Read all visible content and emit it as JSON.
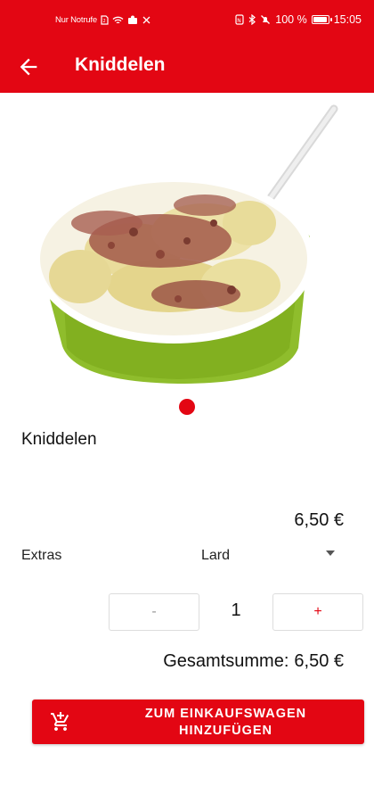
{
  "status_bar": {
    "carrier": "Nur Notrufe",
    "battery": "100 %",
    "battery_level": 1.0,
    "time": "15:05"
  },
  "app_bar": {
    "title": "Kniddelen",
    "back_icon": "arrow-back-icon"
  },
  "product": {
    "name": "Kniddelen",
    "price": "6,50 €",
    "image_pagination": {
      "current": 1,
      "total": 1
    }
  },
  "extras": {
    "label": "Extras",
    "selected": "Lard"
  },
  "quantity": {
    "minus_label": "-",
    "plus_label": "+",
    "value": "1"
  },
  "total": {
    "label": "Gesamtsumme:",
    "value": "6,50 €"
  },
  "cart_button": {
    "line1": "ZUM EINKAUFSWAGEN",
    "line2": "HINZUFÜGEN",
    "icon": "cart-add-icon"
  },
  "colors": {
    "primary": "#e30613",
    "bowl": "#8fbd2c"
  }
}
